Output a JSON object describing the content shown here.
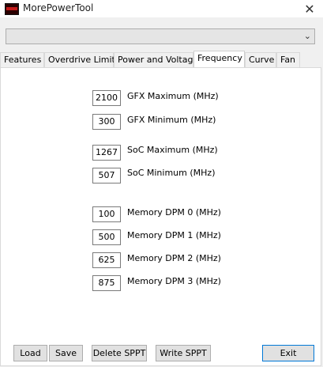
{
  "window": {
    "title": "MorePowerTool",
    "close_glyph": "✕"
  },
  "dropdown": {
    "selected": "",
    "icon": "chevron-down-icon"
  },
  "tabs": [
    {
      "label": "Features"
    },
    {
      "label": "Overdrive Limits"
    },
    {
      "label": "Power and Voltage"
    },
    {
      "label": "Frequency",
      "active": true
    },
    {
      "label": "Curve"
    },
    {
      "label": "Fan"
    }
  ],
  "fields": [
    {
      "value": "2100",
      "label": "GFX Maximum (MHz)"
    },
    {
      "value": "300",
      "label": "GFX Minimum (MHz)"
    },
    {
      "value": "1267",
      "label": "SoC Maximum (MHz)"
    },
    {
      "value": "507",
      "label": "SoC Minimum (MHz)"
    },
    {
      "value": "100",
      "label": "Memory DPM 0 (MHz)"
    },
    {
      "value": "500",
      "label": "Memory DPM 1 (MHz)"
    },
    {
      "value": "625",
      "label": "Memory DPM 2 (MHz)"
    },
    {
      "value": "875",
      "label": "Memory DPM 3 (MHz)"
    }
  ],
  "buttons": {
    "load": "Load",
    "save": "Save",
    "delete_sppt": "Delete SPPT",
    "write_sppt": "Write SPPT",
    "exit": "Exit"
  }
}
